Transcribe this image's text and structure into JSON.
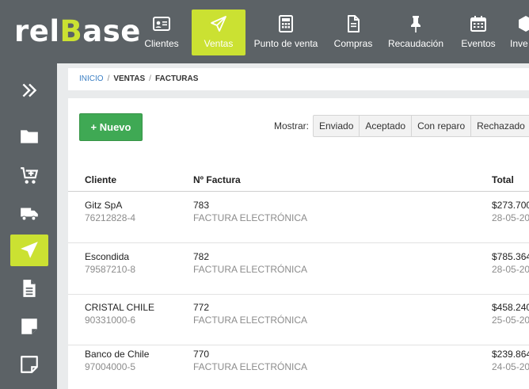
{
  "brand": {
    "logo_prefix": "rel",
    "logo_b": "B",
    "logo_suffix": "ase",
    "accent": "#cbe132",
    "bar_color": "#5c6266"
  },
  "topnav": [
    {
      "label": "Clientes",
      "icon": "id-card-icon"
    },
    {
      "label": "Ventas",
      "icon": "paper-plane-icon",
      "active": true
    },
    {
      "label": "Punto de venta",
      "icon": "calculator-icon"
    },
    {
      "label": "Compras",
      "icon": "document-icon"
    },
    {
      "label": "Recaudación",
      "icon": "pin-icon"
    },
    {
      "label": "Eventos",
      "icon": "calendar-icon"
    },
    {
      "label": "Inve",
      "icon": "box-icon"
    }
  ],
  "breadcrumb": {
    "home": "INICIO",
    "sep": "/",
    "section": "VENTAS",
    "page": "FACTURAS"
  },
  "toolbar": {
    "new_label": "+ Nuevo",
    "show_label": "Mostrar:",
    "filters": [
      "Enviado",
      "Aceptado",
      "Con reparo",
      "Rechazado"
    ]
  },
  "table": {
    "headers": {
      "client": "Cliente",
      "invoice": "Nº Factura",
      "total": "Total"
    },
    "rows": [
      {
        "client": "Gitz SpA",
        "rut": "76212828-4",
        "number": "783",
        "type": "FACTURA ELECTRÓNICA",
        "total": "$273.700",
        "date": "28-05-20"
      },
      {
        "client": "Escondida",
        "rut": "79587210-8",
        "number": "782",
        "type": "FACTURA ELECTRÓNICA",
        "total": "$785.364",
        "date": "28-05-20"
      },
      {
        "client": "CRISTAL CHILE",
        "rut": "90331000-6",
        "number": "772",
        "type": "FACTURA ELECTRÓNICA",
        "total": "$458.240",
        "date": "25-05-20"
      },
      {
        "client": "Banco de Chile",
        "rut": "97004000-5",
        "number": "770",
        "type": "FACTURA ELECTRÓNICA",
        "total": "$239.864",
        "date": "24-05-20"
      }
    ]
  }
}
